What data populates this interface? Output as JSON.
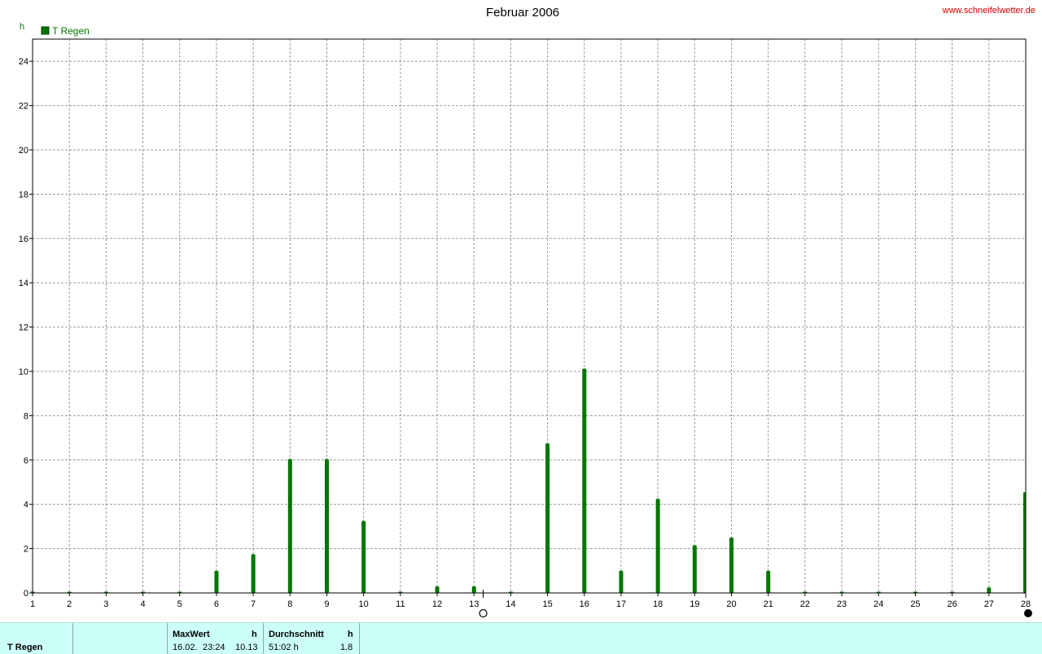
{
  "brand_url": "www.schneifelwetter.de",
  "colors": {
    "series": "#007700",
    "footer_bg": "#ccfff7",
    "brand": "#cc0000",
    "grid": "#9a9a9a"
  },
  "chart_data": {
    "type": "bar",
    "title": "Februar 2006",
    "ylabel": "h",
    "ylim": [
      0,
      25
    ],
    "yticks": [
      0,
      2,
      4,
      6,
      8,
      10,
      12,
      14,
      16,
      18,
      20,
      22,
      24
    ],
    "categories": [
      "1",
      "2",
      "3",
      "4",
      "5",
      "6",
      "7",
      "8",
      "9",
      "10",
      "11",
      "12",
      "13",
      "14",
      "15",
      "16",
      "17",
      "18",
      "19",
      "20",
      "21",
      "22",
      "23",
      "24",
      "25",
      "26",
      "27",
      "28"
    ],
    "series": [
      {
        "name": "T Regen",
        "values": [
          0,
          0,
          0,
          0,
          0,
          1.0,
          1.75,
          6.05,
          6.05,
          3.25,
          0,
          0.3,
          0.3,
          0,
          6.75,
          10.13,
          1.0,
          4.25,
          2.15,
          2.5,
          1.0,
          0,
          0,
          0,
          0,
          0,
          0.25,
          4.55
        ]
      }
    ],
    "grid": true,
    "legend": "top-left",
    "moon_phases": [
      {
        "day": 13.25,
        "phase": "full-moon"
      },
      {
        "day": 28,
        "phase": "new-moon"
      }
    ]
  },
  "footer": {
    "series_label": "T Regen",
    "max_header": "MaxWert",
    "max_unit": "h",
    "max_date": "16.02.",
    "max_time": "23:24",
    "max_value": "10.13",
    "avg_header": "Durchschnitt",
    "avg_unit": "h",
    "avg_total": "51:02 h",
    "avg_value": "1.8"
  }
}
